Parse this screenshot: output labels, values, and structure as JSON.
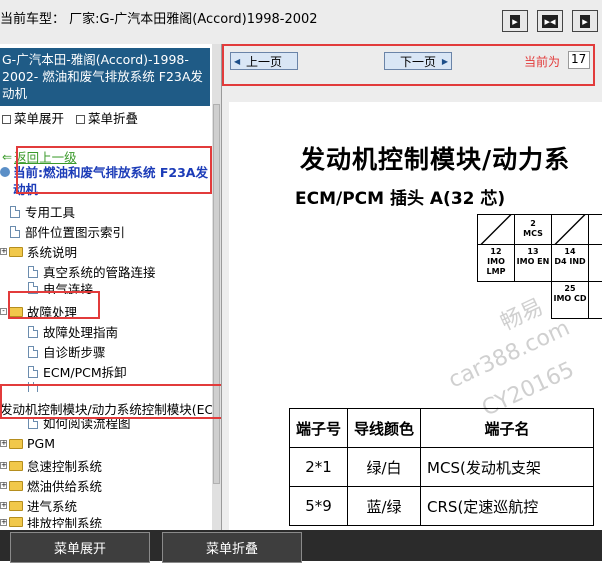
{
  "top_bar": {
    "title": "当前车型：  厂家:G-广汽本田雅阁(Accord)1998-2002"
  },
  "left_panel": {
    "header": "G-广汽本田-雅阁(Accord)-1998-2002- 燃油和废气排放系统 F23A发动机",
    "menu_expand": "菜单展开",
    "menu_collapse": "菜单折叠",
    "back_label": "返回上一级",
    "current_label": "当前:燃油和废气排放系统 F23A发动机",
    "items": [
      "专用工具",
      "部件位置图示索引",
      "系统说明",
      "真空系统的管路连接",
      "电气连接",
      "故障处理",
      "故障处理指南",
      "自诊断步骤",
      "ECM/PCM拆卸",
      "发动机控制模块/动力系统控制模块(EC",
      "如何阅读流程图",
      "PGM",
      "怠速控制系统",
      "燃油供给系统",
      "进气系统",
      "排放控制系统"
    ]
  },
  "content": {
    "prev_page": "上一页",
    "next_page": "下一页",
    "current_label": "当前为",
    "current_page": "17",
    "doc_title": "发动机控制模块/动力系",
    "doc_subtitle": "ECM/PCM 插头 A(32 芯)",
    "pins": [
      {
        "num": "2",
        "name": "MCS"
      },
      {
        "num": "12",
        "name": "IMO LMP"
      },
      {
        "num": "13",
        "name": "IMO EN"
      },
      {
        "num": "14",
        "name": "D4 IND"
      },
      {
        "num": "25",
        "name": "IMO CD"
      }
    ],
    "watermark": [
      "畅易",
      "car388.com",
      "CY20165"
    ],
    "table": {
      "headers": [
        "端子号",
        "导线颜色",
        "端子名"
      ],
      "rows": [
        [
          "2*1",
          "绿/白",
          "MCS(发动机支架"
        ],
        [
          "5*9",
          "蓝/绿",
          "CRS(定速巡航控"
        ]
      ]
    }
  },
  "bottom_bar": {
    "menu_expand": "菜单展开",
    "menu_collapse": "菜单折叠"
  },
  "colors": {
    "header_blue": "#1f5b86",
    "highlight_red": "#e23b3b",
    "back_link_green": "#3a9a2a",
    "current_blue": "#1c3cb8"
  }
}
